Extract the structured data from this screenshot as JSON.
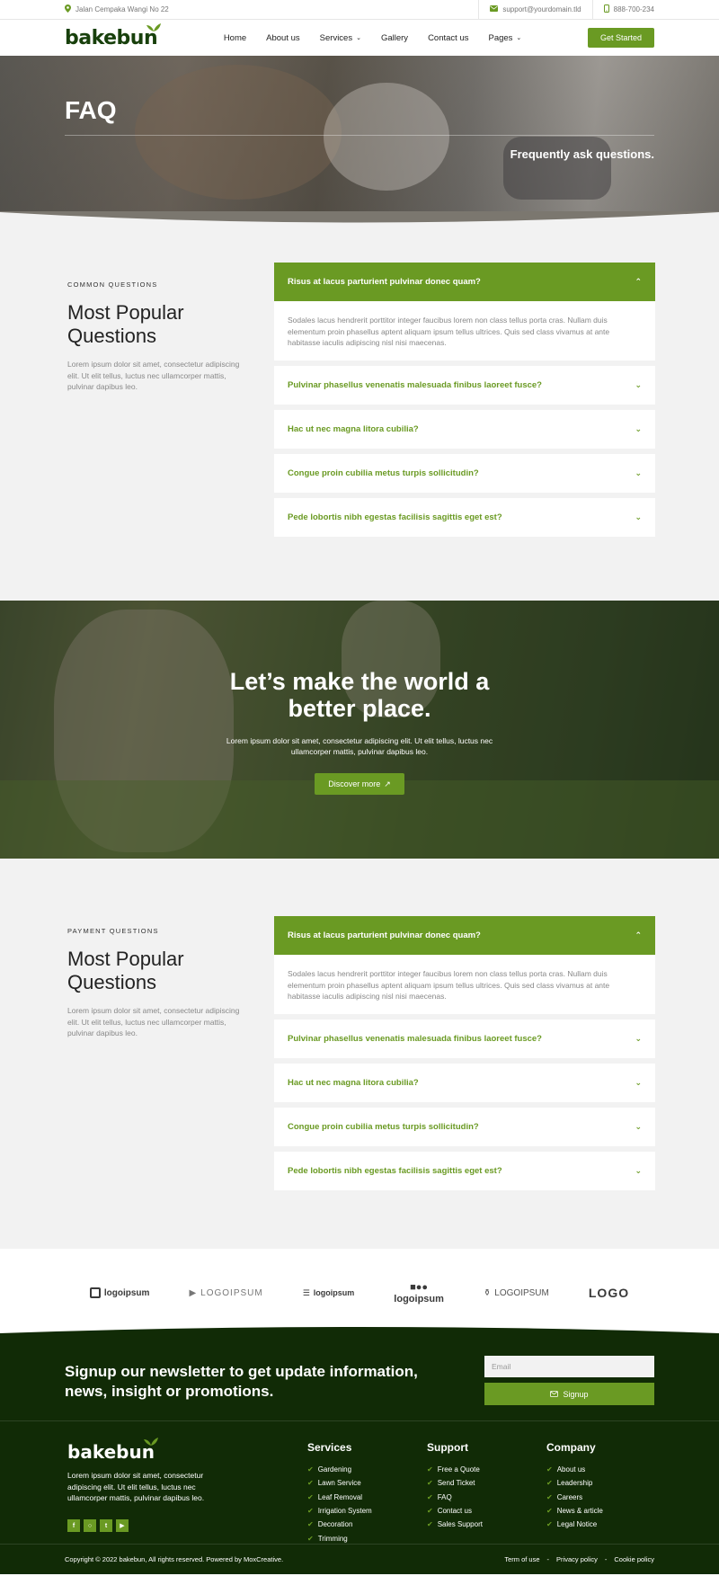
{
  "topbar": {
    "address": "Jalan Cempaka Wangi No 22",
    "email": "support@yourdomain.tld",
    "phone": "888-700-234"
  },
  "header": {
    "logo": "bakebun",
    "nav": [
      {
        "label": "Home"
      },
      {
        "label": "About us"
      },
      {
        "label": "Services",
        "dropdown": true
      },
      {
        "label": "Gallery"
      },
      {
        "label": "Contact us"
      },
      {
        "label": "Pages",
        "dropdown": true
      }
    ],
    "cta": "Get Started"
  },
  "hero": {
    "title": "FAQ",
    "subtitle": "Frequently ask questions."
  },
  "faq_common": {
    "eyebrow": "COMMON QUESTIONS",
    "title": "Most Popular Questions",
    "desc": "Lorem ipsum dolor sit amet, consectetur adipiscing elit. Ut elit tellus, luctus nec ullamcorper mattis, pulvinar dapibus leo.",
    "open": {
      "q": "Risus at lacus parturient pulvinar donec quam?",
      "a": "Sodales lacus hendrerit porttitor integer faucibus lorem non class tellus porta cras. Nullam duis elementum proin phasellus aptent aliquam ipsum tellus ultrices. Quis sed class vivamus at ante habitasse iaculis adipiscing nisl nisi maecenas."
    },
    "items": [
      "Pulvinar phasellus venenatis malesuada finibus laoreet fusce?",
      "Hac ut nec magna litora cubilia?",
      "Congue proin cubilia metus turpis sollicitudin?",
      "Pede lobortis nibh egestas facilisis sagittis eget est?"
    ]
  },
  "cta": {
    "title": "Let’s make the world a better place.",
    "desc": "Lorem ipsum dolor sit amet, consectetur adipiscing elit. Ut elit tellus, luctus nec ullamcorper mattis, pulvinar dapibus leo.",
    "button": "Discover more"
  },
  "faq_payment": {
    "eyebrow": "PAYMENT QUESTIONS",
    "title": "Most Popular Questions",
    "desc": "Lorem ipsum dolor sit amet, consectetur adipiscing elit. Ut elit tellus, luctus nec ullamcorper mattis, pulvinar dapibus leo.",
    "open": {
      "q": "Risus at lacus parturient pulvinar donec quam?",
      "a": "Sodales lacus hendrerit porttitor integer faucibus lorem non class tellus porta cras. Nullam duis elementum proin phasellus aptent aliquam ipsum tellus ultrices. Quis sed class vivamus at ante habitasse iaculis adipiscing nisl nisi maecenas."
    },
    "items": [
      "Pulvinar phasellus venenatis malesuada finibus laoreet fusce?",
      "Hac ut nec magna litora cubilia?",
      "Congue proin cubilia metus turpis sollicitudin?",
      "Pede lobortis nibh egestas facilisis sagittis eget est?"
    ]
  },
  "logos": [
    "logoipsum",
    "LOGOIPSUM",
    "logoipsum",
    "logoipsum",
    "LOGOIPSUM",
    "LOGO"
  ],
  "newsletter": {
    "title": "Signup our newsletter to get update information, news, insight or promotions.",
    "placeholder": "Email",
    "button": "Signup"
  },
  "footer": {
    "logo": "bakebun",
    "desc": "Lorem ipsum dolor sit amet, consectetur adipiscing elit. Ut elit tellus, luctus nec ullamcorper mattis, pulvinar dapibus leo.",
    "columns": [
      {
        "title": "Services",
        "links": [
          "Gardening",
          "Lawn Service",
          "Leaf Removal",
          "Irrigation System",
          "Decoration",
          "Trimming"
        ]
      },
      {
        "title": "Support",
        "links": [
          "Free a Quote",
          "Send Ticket",
          "FAQ",
          "Contact us",
          "Sales Support"
        ]
      },
      {
        "title": "Company",
        "links": [
          "About us",
          "Leadership",
          "Careers",
          "News & article",
          "Legal Notice"
        ]
      }
    ],
    "copyright": "Copyright © 2022 bakebun, All rights reserved. Powered by MoxCreative.",
    "legal": [
      "Term of use",
      "Privacy policy",
      "Cookie policy"
    ]
  },
  "colors": {
    "accent": "#6a9a23",
    "dark": "#112b06"
  }
}
